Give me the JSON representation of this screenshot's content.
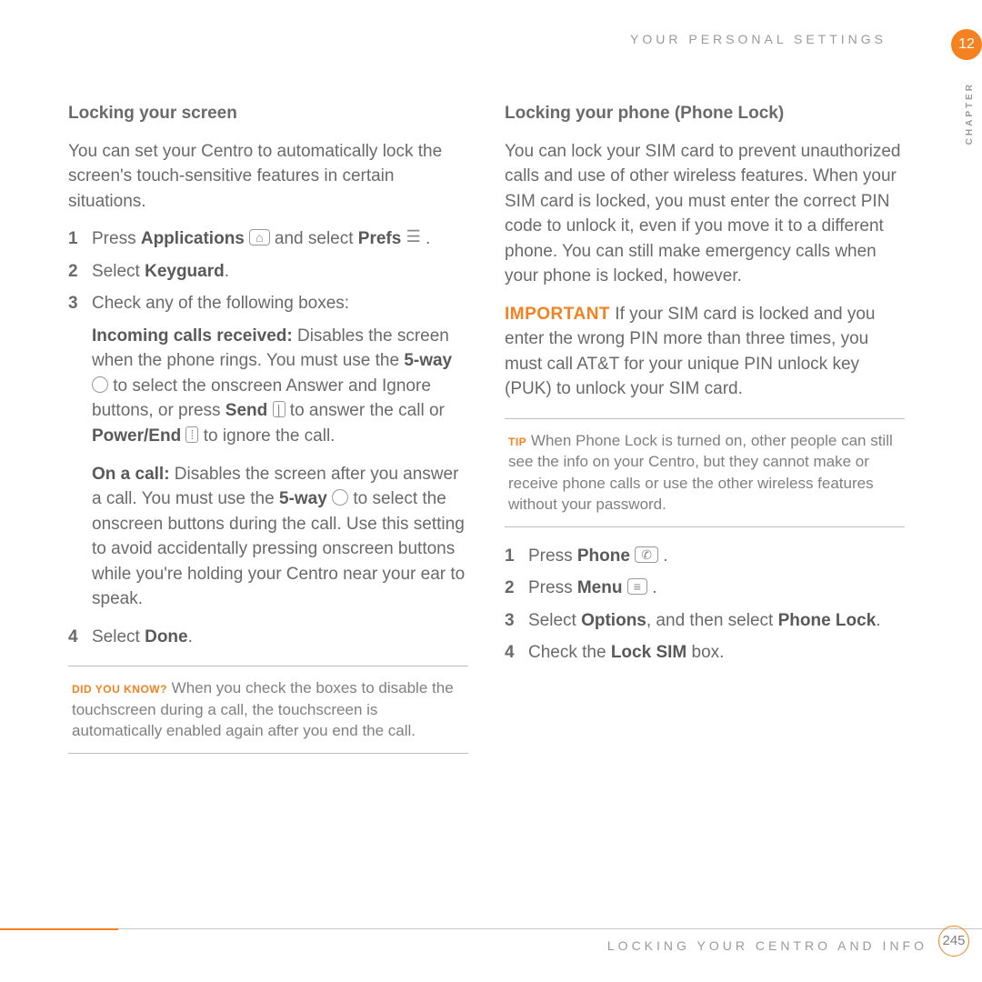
{
  "header": {
    "section": "YOUR PERSONAL SETTINGS"
  },
  "chapter": {
    "number": "12",
    "label": "CHAPTER"
  },
  "left": {
    "heading": "Locking your screen",
    "intro": "You can set your Centro to automatically lock the screen's touch-sensitive features in certain situations.",
    "step1a": "Press ",
    "step1b": "Applications",
    "step1c": " and select ",
    "step1d": "Prefs",
    "step1e": " .",
    "step2a": "Select ",
    "step2b": "Keyguard",
    "step2c": ".",
    "step3": "Check any of the following boxes:",
    "inc_b": "Incoming calls received:",
    "inc_1": " Disables the screen when the phone rings. You must use the ",
    "inc_2": "5-way",
    "inc_3": " to select the onscreen Answer and Ignore buttons, or press ",
    "inc_4": "Send",
    "inc_5": " to answer the call or ",
    "inc_6": "Power/End",
    "inc_7": " to ignore the call.",
    "on_b": "On a call:",
    "on_1": " Disables the screen after you answer a call. You must use the ",
    "on_2": "5-way",
    "on_3": " to select the onscreen buttons during the call. Use this setting to avoid accidentally pressing onscreen buttons while you're holding your Centro near your ear to speak.",
    "step4a": "Select ",
    "step4b": "Done",
    "step4c": ".",
    "dyk_tag": "DID YOU KNOW?",
    "dyk": " When you check the boxes to disable the touchscreen during a call, the touchscreen is automatically enabled again after you end the call."
  },
  "right": {
    "heading": "Locking your phone (Phone Lock)",
    "intro": "You can lock your SIM card to prevent unauthorized calls and use of other wireless features. When your SIM card is locked, you must enter the correct PIN code to unlock it, even if you move it to a different phone. You can still make emergency calls when your phone is locked, however.",
    "imp_tag": "IMPORTANT",
    "imp": " If your SIM card is locked and you enter the wrong PIN more than three times, you must call AT&T for your unique PIN unlock key (PUK) to unlock your SIM card.",
    "tip_tag": "TIP",
    "tip": " When Phone Lock is turned on, other people can still see the info on your Centro, but they cannot make or receive phone calls or use the other wireless features without your password.",
    "s1a": "Press ",
    "s1b": "Phone",
    "s1c": " .",
    "s2a": "Press ",
    "s2b": "Menu",
    "s2c": " .",
    "s3a": "Select ",
    "s3b": "Options",
    "s3c": ", and then select ",
    "s3d": "Phone Lock",
    "s3e": ".",
    "s4a": "Check the ",
    "s4b": "Lock SIM",
    "s4c": " box."
  },
  "footer": {
    "text": "LOCKING YOUR CENTRO AND INFO",
    "page": "245"
  },
  "icons": {
    "home": "⌂",
    "prefs": "☰",
    "nav": " ",
    "send": "|",
    "end": "⁞",
    "phone": "✆",
    "menu": "≡"
  }
}
